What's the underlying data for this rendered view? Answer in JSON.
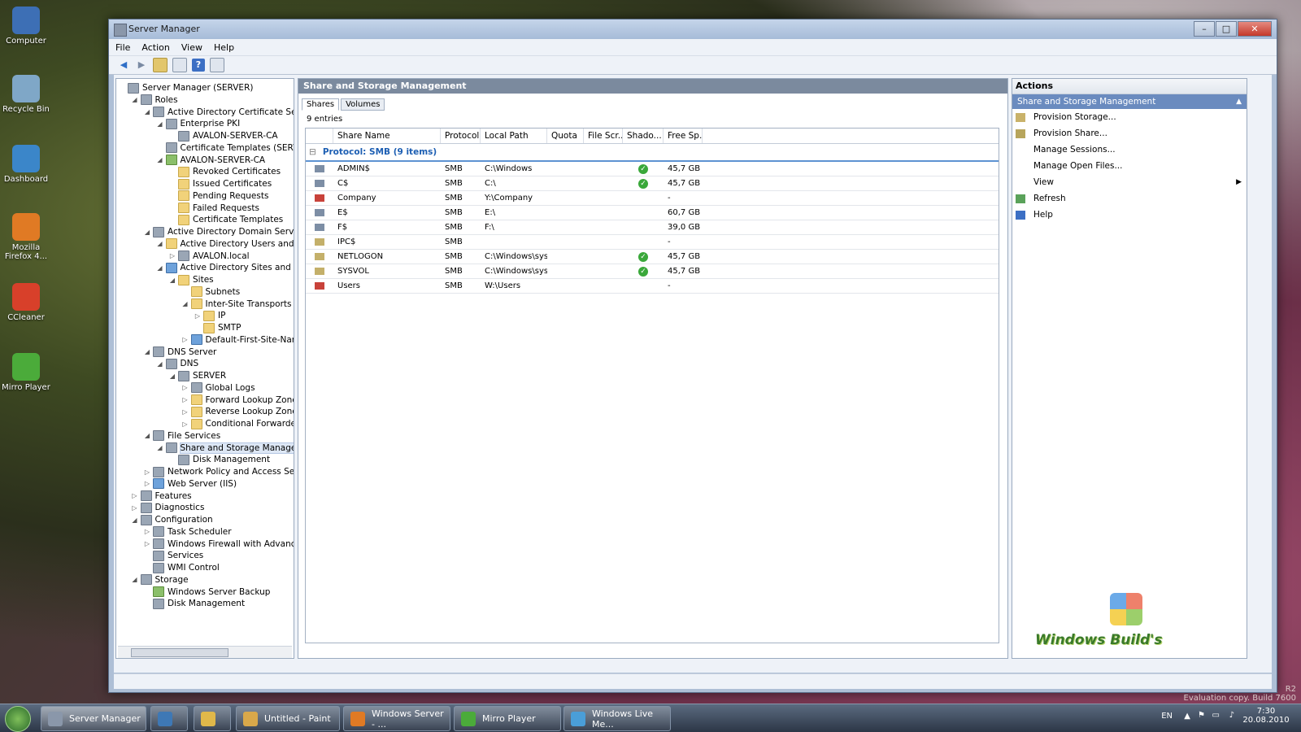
{
  "desktop": {
    "icons": [
      {
        "label": "Computer",
        "color": "#3d6fb5"
      },
      {
        "label": "Recycle Bin",
        "color": "#7fa7c7"
      },
      {
        "label": "Dashboard",
        "color": "#3b86c9"
      },
      {
        "label": "Mozilla Firefox 4...",
        "color": "#e07a24"
      },
      {
        "label": "CCleaner",
        "color": "#d8402a"
      },
      {
        "label": "Mirro Player",
        "color": "#4bab3a"
      }
    ]
  },
  "window": {
    "title": "Server Manager",
    "buttons": {
      "minimize": "–",
      "maximize": "□",
      "close": "✕"
    }
  },
  "menu": [
    "File",
    "Action",
    "View",
    "Help"
  ],
  "toolbar": {
    "icons": [
      "back-icon",
      "forward-icon",
      "up-icon",
      "show-hide-tree-icon",
      "help-icon",
      "properties-icon"
    ]
  },
  "tree": [
    {
      "label": "Server Manager (SERVER)",
      "level": 0,
      "arrow": "",
      "icon": "gray"
    },
    {
      "label": "Roles",
      "level": 1,
      "arrow": "◢",
      "icon": "gray"
    },
    {
      "label": "Active Directory Certificate Services",
      "level": 2,
      "arrow": "◢",
      "icon": "gray"
    },
    {
      "label": "Enterprise PKI",
      "level": 3,
      "arrow": "◢",
      "icon": "gray"
    },
    {
      "label": "AVALON-SERVER-CA",
      "level": 4,
      "arrow": "",
      "icon": "gray"
    },
    {
      "label": "Certificate Templates (SERVER.AVA",
      "level": 3,
      "arrow": "",
      "icon": "gray"
    },
    {
      "label": "AVALON-SERVER-CA",
      "level": 3,
      "arrow": "◢",
      "icon": "green"
    },
    {
      "label": "Revoked Certificates",
      "level": 4,
      "arrow": "",
      "icon": "folder"
    },
    {
      "label": "Issued Certificates",
      "level": 4,
      "arrow": "",
      "icon": "folder"
    },
    {
      "label": "Pending Requests",
      "level": 4,
      "arrow": "",
      "icon": "folder"
    },
    {
      "label": "Failed Requests",
      "level": 4,
      "arrow": "",
      "icon": "folder"
    },
    {
      "label": "Certificate Templates",
      "level": 4,
      "arrow": "",
      "icon": "folder"
    },
    {
      "label": "Active Directory Domain Services",
      "level": 2,
      "arrow": "◢",
      "icon": "gray"
    },
    {
      "label": "Active Directory Users and Comput",
      "level": 3,
      "arrow": "◢",
      "icon": "folder"
    },
    {
      "label": "AVALON.local",
      "level": 4,
      "arrow": "▷",
      "icon": "gray"
    },
    {
      "label": "Active Directory Sites and Services [",
      "level": 3,
      "arrow": "◢",
      "icon": "blue"
    },
    {
      "label": "Sites",
      "level": 4,
      "arrow": "◢",
      "icon": "folder"
    },
    {
      "label": "Subnets",
      "level": 5,
      "arrow": "",
      "icon": "folder"
    },
    {
      "label": "Inter-Site Transports",
      "level": 5,
      "arrow": "◢",
      "icon": "folder"
    },
    {
      "label": "IP",
      "level": 6,
      "arrow": "▷",
      "icon": "folder"
    },
    {
      "label": "SMTP",
      "level": 6,
      "arrow": "",
      "icon": "folder"
    },
    {
      "label": "Default-First-Site-Name",
      "level": 5,
      "arrow": "▷",
      "icon": "blue"
    },
    {
      "label": "DNS Server",
      "level": 2,
      "arrow": "◢",
      "icon": "gray"
    },
    {
      "label": "DNS",
      "level": 3,
      "arrow": "◢",
      "icon": "gray"
    },
    {
      "label": "SERVER",
      "level": 4,
      "arrow": "◢",
      "icon": "gray"
    },
    {
      "label": "Global Logs",
      "level": 5,
      "arrow": "▷",
      "icon": "gray"
    },
    {
      "label": "Forward Lookup Zones",
      "level": 5,
      "arrow": "▷",
      "icon": "folder"
    },
    {
      "label": "Reverse Lookup Zones",
      "level": 5,
      "arrow": "▷",
      "icon": "folder"
    },
    {
      "label": "Conditional Forwarders",
      "level": 5,
      "arrow": "▷",
      "icon": "folder"
    },
    {
      "label": "File Services",
      "level": 2,
      "arrow": "◢",
      "icon": "gray"
    },
    {
      "label": "Share and Storage Management",
      "level": 3,
      "arrow": "◢",
      "icon": "gray",
      "selected": true
    },
    {
      "label": "Disk Management",
      "level": 4,
      "arrow": "",
      "icon": "gray"
    },
    {
      "label": "Network Policy and Access Services",
      "level": 2,
      "arrow": "▷",
      "icon": "gray"
    },
    {
      "label": "Web Server (IIS)",
      "level": 2,
      "arrow": "▷",
      "icon": "blue"
    },
    {
      "label": "Features",
      "level": 1,
      "arrow": "▷",
      "icon": "gray"
    },
    {
      "label": "Diagnostics",
      "level": 1,
      "arrow": "▷",
      "icon": "gray"
    },
    {
      "label": "Configuration",
      "level": 1,
      "arrow": "◢",
      "icon": "gray"
    },
    {
      "label": "Task Scheduler",
      "level": 2,
      "arrow": "▷",
      "icon": "gray"
    },
    {
      "label": "Windows Firewall with Advanced Secu",
      "level": 2,
      "arrow": "▷",
      "icon": "gray"
    },
    {
      "label": "Services",
      "level": 2,
      "arrow": "",
      "icon": "gray"
    },
    {
      "label": "WMI Control",
      "level": 2,
      "arrow": "",
      "icon": "gray"
    },
    {
      "label": "Storage",
      "level": 1,
      "arrow": "◢",
      "icon": "gray"
    },
    {
      "label": "Windows Server Backup",
      "level": 2,
      "arrow": "",
      "icon": "green"
    },
    {
      "label": "Disk Management",
      "level": 2,
      "arrow": "",
      "icon": "gray"
    }
  ],
  "center": {
    "header": "Share and Storage Management",
    "tabs": [
      "Shares",
      "Volumes"
    ],
    "entries": "9 entries",
    "columns": [
      "",
      "Share Name",
      "Protocol",
      "Local Path",
      "Quota",
      "File Scr...",
      "Shado...",
      "Free Sp..."
    ],
    "group_label": "Protocol: SMB (9 items)",
    "group_toggle": "⊟",
    "rows": [
      {
        "name": "ADMIN$",
        "protocol": "SMB",
        "path": "C:\\Windows",
        "quota": "",
        "filescreen": "",
        "shadow": true,
        "free": "45,7 GB",
        "icon_color": "#7d8ea5"
      },
      {
        "name": "C$",
        "protocol": "SMB",
        "path": "C:\\",
        "quota": "",
        "filescreen": "",
        "shadow": true,
        "free": "45,7 GB",
        "icon_color": "#7d8ea5"
      },
      {
        "name": "Company",
        "protocol": "SMB",
        "path": "Y:\\Company",
        "quota": "",
        "filescreen": "",
        "shadow": false,
        "free": "-",
        "icon_color": "#c8423a"
      },
      {
        "name": "E$",
        "protocol": "SMB",
        "path": "E:\\",
        "quota": "",
        "filescreen": "",
        "shadow": false,
        "free": "60,7 GB",
        "icon_color": "#7d8ea5"
      },
      {
        "name": "F$",
        "protocol": "SMB",
        "path": "F:\\",
        "quota": "",
        "filescreen": "",
        "shadow": false,
        "free": "39,0 GB",
        "icon_color": "#7d8ea5"
      },
      {
        "name": "IPC$",
        "protocol": "SMB",
        "path": "",
        "quota": "",
        "filescreen": "",
        "shadow": false,
        "free": "-",
        "icon_color": "#c4b06a"
      },
      {
        "name": "NETLOGON",
        "protocol": "SMB",
        "path": "C:\\Windows\\sys...",
        "quota": "",
        "filescreen": "",
        "shadow": true,
        "free": "45,7 GB",
        "icon_color": "#c4b06a"
      },
      {
        "name": "SYSVOL",
        "protocol": "SMB",
        "path": "C:\\Windows\\sys...",
        "quota": "",
        "filescreen": "",
        "shadow": true,
        "free": "45,7 GB",
        "icon_color": "#c4b06a"
      },
      {
        "name": "Users",
        "protocol": "SMB",
        "path": "W:\\Users",
        "quota": "",
        "filescreen": "",
        "shadow": false,
        "free": "-",
        "icon_color": "#c8423a"
      }
    ],
    "check_glyph": "✓"
  },
  "actions": {
    "title": "Actions",
    "section": "Share and Storage Management",
    "section_caret": "▲",
    "items": [
      {
        "label": "Provision Storage...",
        "icon_color": "#c9b26a"
      },
      {
        "label": "Provision Share...",
        "icon_color": "#b7a55c"
      },
      {
        "label": "Manage Sessions...",
        "icon_color": ""
      },
      {
        "label": "Manage Open Files...",
        "icon_color": ""
      },
      {
        "label": "View",
        "icon_color": "",
        "submenu": "▶"
      },
      {
        "label": "Refresh",
        "icon_color": "#5aa25a"
      },
      {
        "label": "Help",
        "icon_color": "#3c6fc4"
      }
    ],
    "watermark": "Windows Build's"
  },
  "taskbar": {
    "tasks": [
      {
        "label": "Server Manager",
        "color": "#8a97aa",
        "active": true
      },
      {
        "label": "",
        "color": "#3e78b5"
      },
      {
        "label": "",
        "color": "#e0b84a"
      },
      {
        "label": "Untitled - Paint",
        "color": "#d9a84a"
      },
      {
        "label": "Windows Server - ...",
        "color": "#e07a24"
      },
      {
        "label": "Mirro Player",
        "color": "#4bab3a"
      },
      {
        "label": "Windows Live Me...",
        "color": "#4a9ed8"
      }
    ],
    "lang": "EN",
    "time": "7:30",
    "date": "20.08.2010",
    "eval_line1": "R2",
    "eval_line2": "Evaluation copy. Build 7600"
  }
}
